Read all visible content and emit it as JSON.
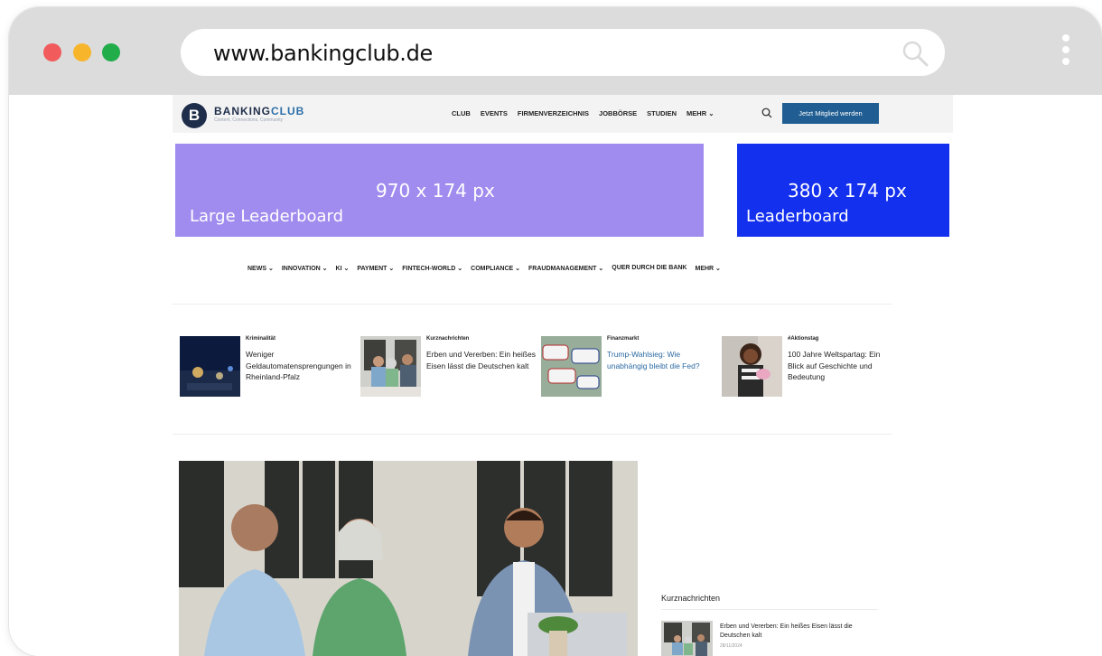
{
  "browser": {
    "url": "www.bankingclub.de"
  },
  "topnav": {
    "logo_letter": "B",
    "logo_text_a": "BANKING",
    "logo_text_b": "CLUB",
    "tagline": "Content, Connections, Community",
    "items": [
      "CLUB",
      "EVENTS",
      "FIRMENVERZEICHNIS",
      "JOBBÖRSE",
      "STUDIEN",
      "MEHR ⌄"
    ],
    "cta": "Jetzt Mitglied werden"
  },
  "ads": [
    {
      "size": "970 x 174 px",
      "name": "Large Leaderboard",
      "color": "#a08bee"
    },
    {
      "size": "380 x 174 px",
      "name": "Leaderboard",
      "color": "#1430ef"
    }
  ],
  "catnav": [
    "NEWS ⌄",
    "INNOVATION ⌄",
    "KI ⌄",
    "PAYMENT ⌄",
    "FINTECH-WORLD ⌄",
    "COMPLIANCE ⌄",
    "FRAUDMANAGEMENT ⌄",
    "QUER DURCH DIE BANK",
    "MEHR ⌄"
  ],
  "teasers": [
    {
      "kicker": "Kriminalität",
      "title": "Weniger Geldautomatensprengungen in Rheinland-Pfalz",
      "highlight": false
    },
    {
      "kicker": "Kurznachrichten",
      "title": "Erben und Vererben: Ein heißes Eisen lässt die Deutschen kalt",
      "highlight": false
    },
    {
      "kicker": "Finanzmarkt",
      "title": "Trump-Wahlsieg: Wie unabhängig bleibt die Fed?",
      "highlight": true
    },
    {
      "kicker": "#Aktionstag",
      "title": "100 Jahre Weltspartag: Ein Blick auf Geschichte und Bedeutung",
      "highlight": false
    }
  ],
  "sidebar": {
    "heading": "Kurznachrichten",
    "item_title": "Erben und Vererben: Ein heißes Eisen lässt die Deutschen kalt",
    "item_date": "28/11/2024"
  },
  "colors": {
    "brand_dark": "#1e2d4a",
    "brand_blue": "#1f5d92",
    "link_blue": "#2c6aa3"
  }
}
